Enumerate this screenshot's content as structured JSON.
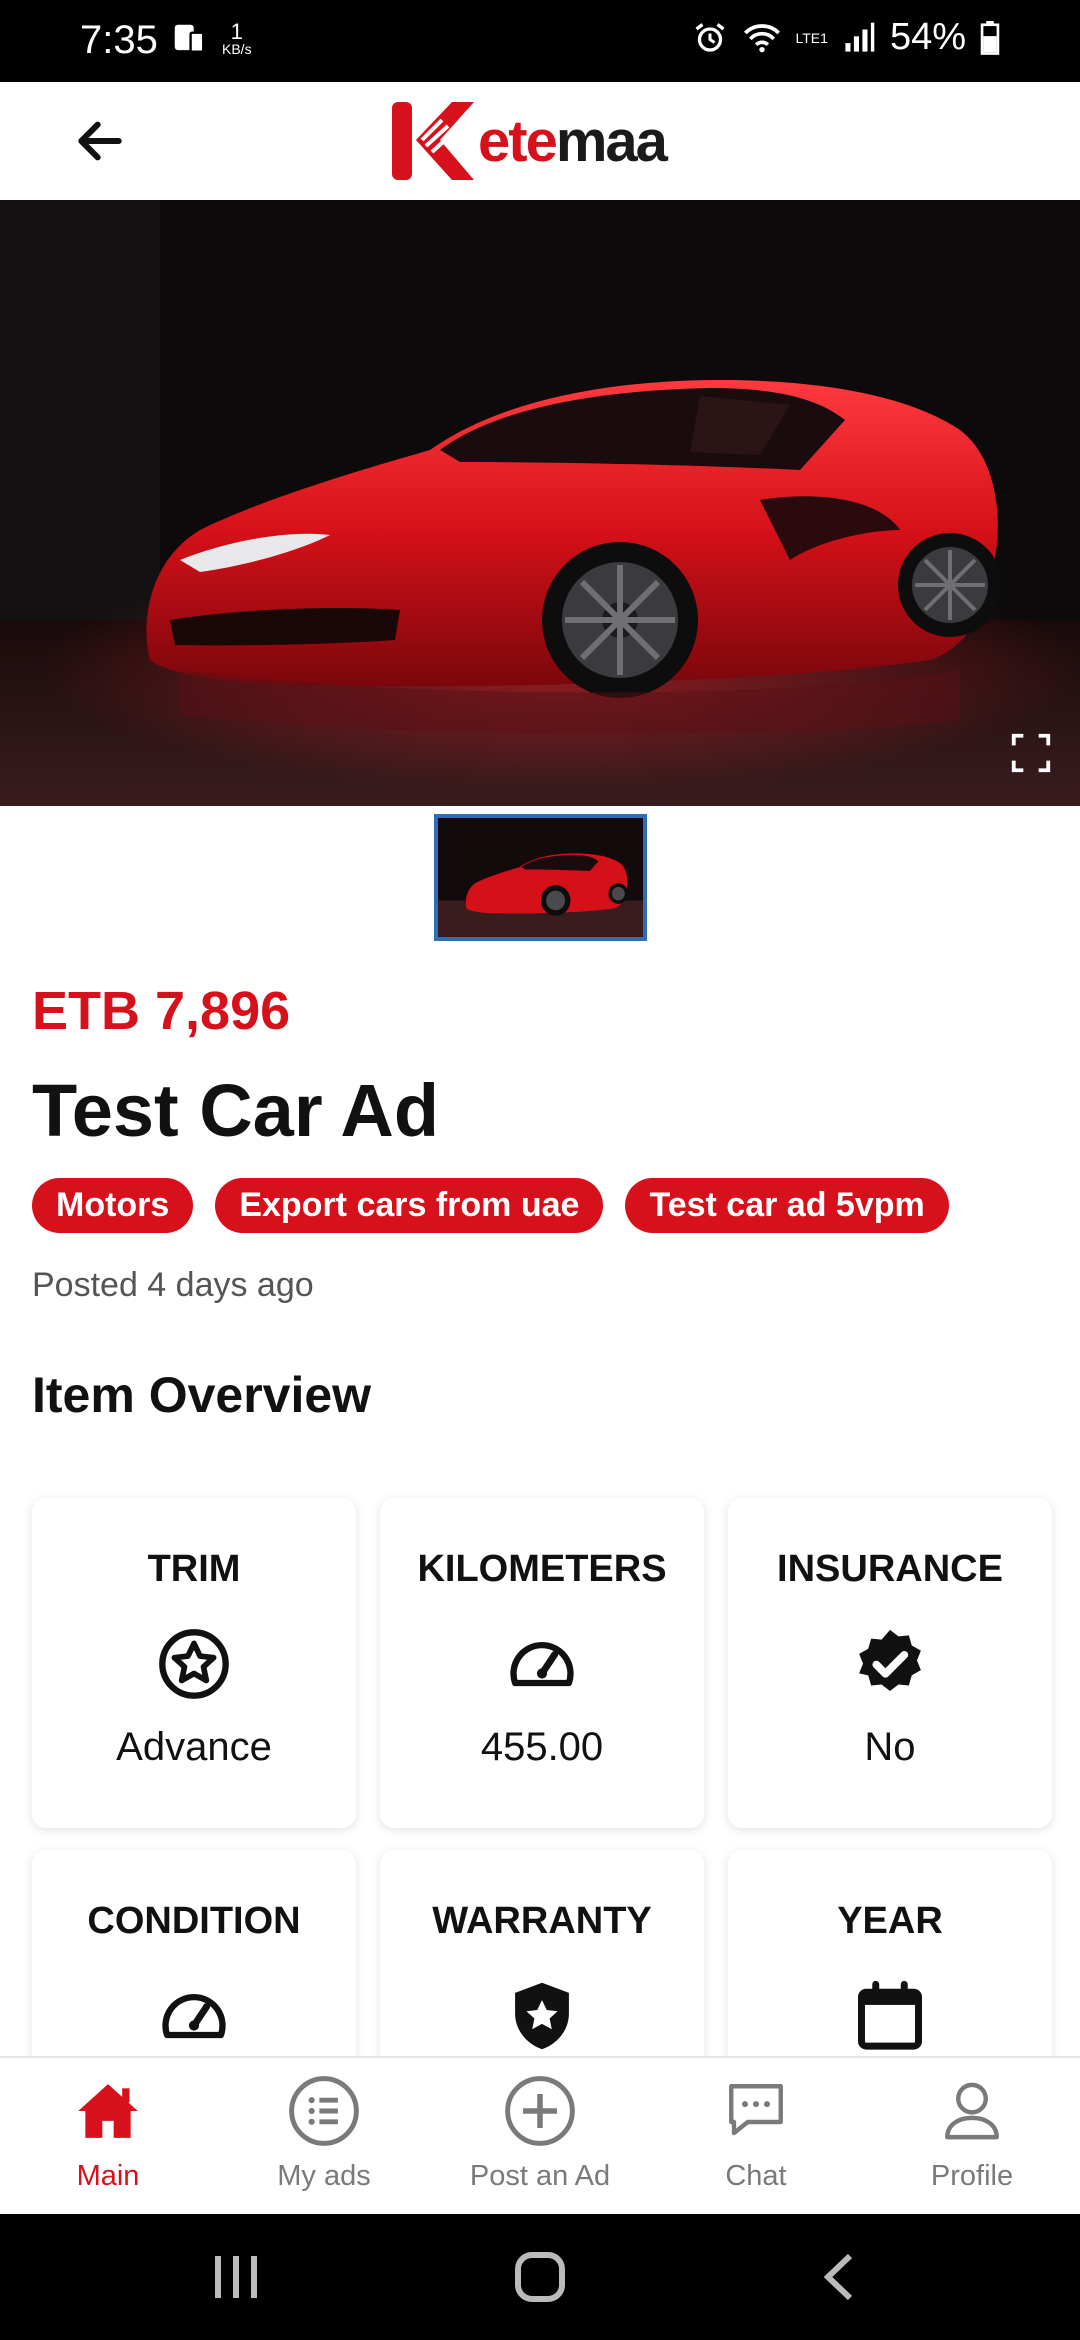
{
  "status_bar": {
    "time": "7:35",
    "net_speed": "1",
    "net_unit": "KB/s",
    "network": "LTE1",
    "battery": "54%"
  },
  "header": {
    "logo_text_red": "k",
    "logo_text_dark": "etemaa",
    "logo_wordmark": "ketemaa"
  },
  "listing": {
    "price": "ETB 7,896",
    "title": "Test Car Ad",
    "tags": [
      "Motors",
      "Export cars from uae",
      "Test car ad 5vpm"
    ],
    "posted": "Posted 4 days ago"
  },
  "overview": {
    "title": "Item Overview",
    "items": [
      {
        "label": "TRIM",
        "icon": "star-circle-icon",
        "value": "Advance"
      },
      {
        "label": "KILOMETERS",
        "icon": "speedometer-icon",
        "value": "455.00"
      },
      {
        "label": "INSURANCE",
        "icon": "verified-badge-icon",
        "value": "No"
      },
      {
        "label": "CONDITION",
        "icon": "speedometer-icon",
        "value": ""
      },
      {
        "label": "WARRANTY",
        "icon": "shield-star-icon",
        "value": ""
      },
      {
        "label": "YEAR",
        "icon": "calendar-icon",
        "value": ""
      }
    ]
  },
  "bottom_nav": [
    {
      "label": "Main",
      "icon": "home-icon",
      "active": true
    },
    {
      "label": "My ads",
      "icon": "list-icon",
      "active": false
    },
    {
      "label": "Post an Ad",
      "icon": "plus-circle-icon",
      "active": false
    },
    {
      "label": "Chat",
      "icon": "chat-icon",
      "active": false
    },
    {
      "label": "Profile",
      "icon": "person-icon",
      "active": false
    }
  ],
  "colors": {
    "brand_red": "#d7111b",
    "thumb_border": "#2f6db5",
    "inactive_nav": "#7a7a7a"
  }
}
